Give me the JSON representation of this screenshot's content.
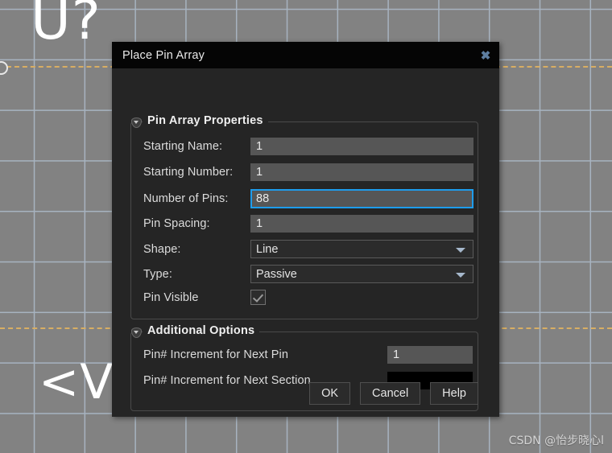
{
  "canvas": {
    "labels": [
      {
        "name": "u-designator",
        "text": "U?"
      },
      {
        "name": "value-placeholder",
        "text": "<Va"
      }
    ],
    "watermark": "CSDN @怡步晓心l",
    "grid_color": "#aebccb",
    "background_color": "#828282",
    "net_color": "#d8ae63"
  },
  "dialog": {
    "title": "Place Pin Array",
    "close_icon": "✖",
    "groups": [
      {
        "id": "pin_array_properties",
        "title": "Pin Array Properties",
        "collapse_icon": "chevron-down-icon",
        "fields": [
          {
            "name": "starting-name",
            "label": "Starting Name:",
            "value": "1",
            "kind": "text",
            "focused": false
          },
          {
            "name": "starting-number",
            "label": "Starting Number:",
            "value": "1",
            "kind": "text",
            "focused": false
          },
          {
            "name": "number-of-pins",
            "label": "Number of Pins:",
            "value": "88",
            "kind": "text",
            "focused": true
          },
          {
            "name": "pin-spacing",
            "label": "Pin Spacing:",
            "value": "1",
            "kind": "text",
            "focused": false
          },
          {
            "name": "shape",
            "label": "Shape:",
            "value": "Line",
            "kind": "select",
            "focused": false
          },
          {
            "name": "type",
            "label": "Type:",
            "value": "Passive",
            "kind": "select",
            "focused": false
          },
          {
            "name": "pin-visible",
            "label": "Pin Visible",
            "value": "",
            "kind": "checkbox",
            "checked": true
          }
        ]
      },
      {
        "id": "additional_options",
        "title": "Additional Options",
        "collapse_icon": "chevron-down-icon",
        "fields": [
          {
            "name": "pin-increment-next-pin",
            "label": "Pin# Increment for Next Pin",
            "value": "1",
            "kind": "text",
            "focused": false
          },
          {
            "name": "pin-increment-next-section",
            "label": "Pin# Increment for Next Section",
            "value": "",
            "kind": "text",
            "focused": false,
            "empty_black": true
          }
        ]
      }
    ],
    "buttons": [
      {
        "name": "ok-button",
        "label": "OK"
      },
      {
        "name": "cancel-button",
        "label": "Cancel"
      },
      {
        "name": "help-button",
        "label": "Help"
      }
    ],
    "accent_focus_color": "#1e9cec",
    "input_bg_color": "#565656",
    "surface_color": "#252525",
    "titlebar_color": "#050505"
  }
}
